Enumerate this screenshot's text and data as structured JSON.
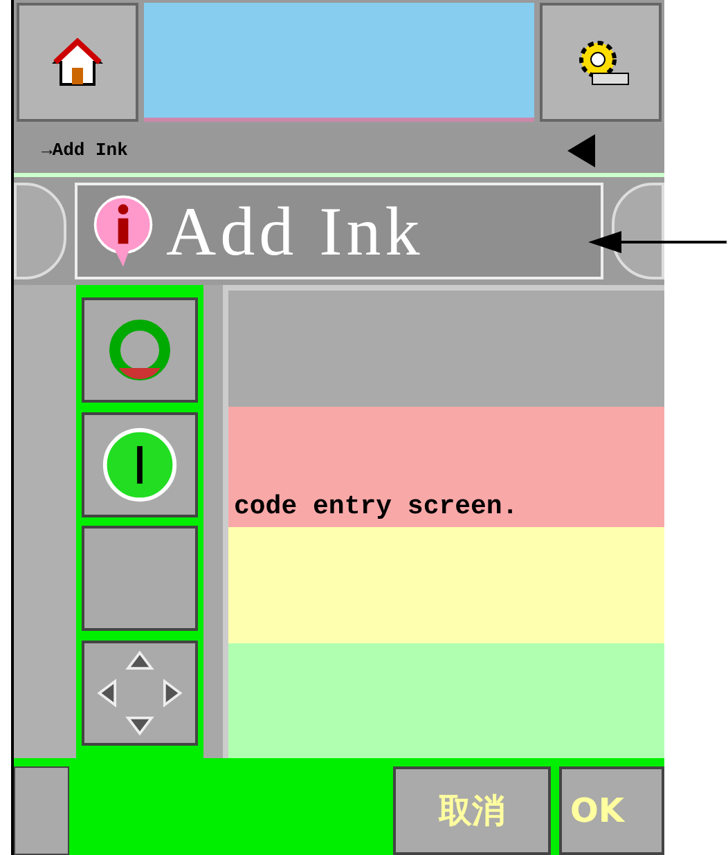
{
  "breadcrumb": "→Add Ink",
  "title": "Add Ink",
  "message": "code entry screen.",
  "buttons": [
    {
      "kind": "cancel",
      "label": "取消"
    },
    {
      "kind": "ok",
      "label": "OK"
    }
  ]
}
